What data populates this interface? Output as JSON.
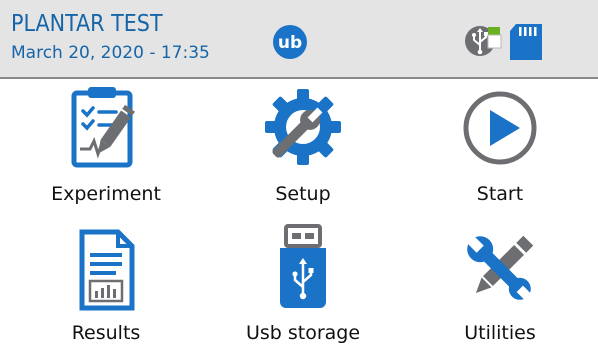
{
  "header": {
    "title": "PLANTAR TEST",
    "datetime": "March 20, 2020 - 17:35",
    "logo_text": "ub",
    "status_icons": [
      "usb-connected-icon",
      "sd-card-icon"
    ]
  },
  "menu": {
    "items": [
      {
        "label": "Experiment",
        "icon": "clipboard-icon"
      },
      {
        "label": "Setup",
        "icon": "gear-wrench-icon"
      },
      {
        "label": "Start",
        "icon": "play-icon"
      },
      {
        "label": "Results",
        "icon": "document-chart-icon"
      },
      {
        "label": "Usb storage",
        "icon": "usb-drive-icon"
      },
      {
        "label": "Utilities",
        "icon": "tools-icon"
      }
    ]
  },
  "colors": {
    "accent": "#1a73c6",
    "dark_accent": "#1565a8",
    "gray": "#6d6e71",
    "header_bg": "#e4e4e4"
  }
}
